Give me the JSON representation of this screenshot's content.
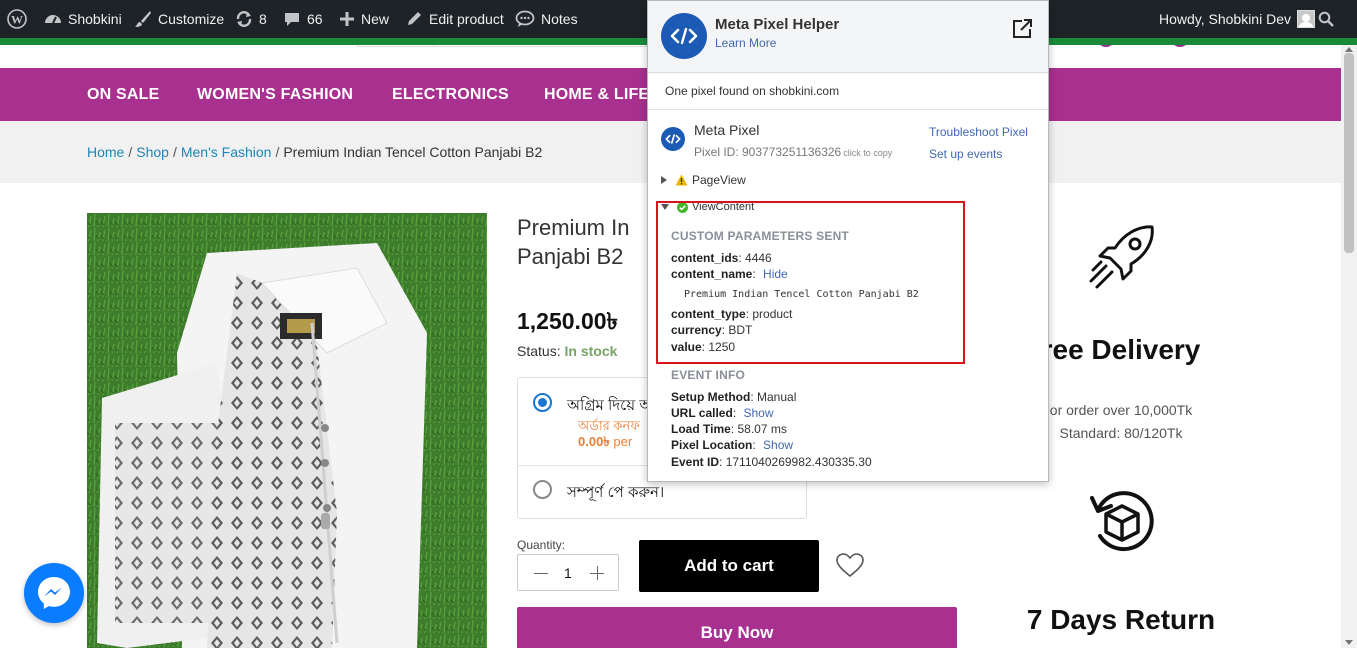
{
  "adminbar": {
    "items": [
      {
        "label": "Shobkini",
        "icon": "dashboard-icon"
      },
      {
        "label": "Customize",
        "icon": "brush-icon"
      },
      {
        "label": "8",
        "icon": "updates-icon"
      },
      {
        "label": "66",
        "icon": "comments-icon"
      },
      {
        "label": "New",
        "icon": "plus-icon"
      },
      {
        "label": "Edit product",
        "icon": "pencil-icon"
      },
      {
        "label": "Notes",
        "icon": "notes-icon"
      }
    ],
    "howdy": "Howdy, Shobkini Dev"
  },
  "nav": {
    "items": [
      "ON SALE",
      "WOMEN'S FASHION",
      "ELECTRONICS",
      "HOME & LIFE"
    ]
  },
  "breadcrumb": {
    "home": "Home",
    "shop": "Shop",
    "category": "Men's Fashion",
    "current": "Premium Indian Tencel Cotton Panjabi B2",
    "sep": "/"
  },
  "product": {
    "title": "Premium In Panjabi B2",
    "price": "1,250.00৳",
    "status_label": "Status:",
    "status_value": "In stock",
    "payment": {
      "option1": "অগ্রিম দিয়ে অ",
      "option1_sub": "অর্ডার কনফ",
      "option1_price": "0.00৳",
      "option1_price_suffix": "per",
      "option2": "সম্পূর্ণ পে করুন।"
    },
    "quantity_label": "Quantity:",
    "quantity": "1",
    "add_to_cart": "Add to cart",
    "buy_now": "Buy Now"
  },
  "features": {
    "delivery_title": "ree Delivery",
    "delivery_line1": "or order over 10,000Tk",
    "delivery_line2": "Standard: 80/120Tk",
    "return_title": "7 Days Return"
  },
  "pixel_helper": {
    "title": "Meta Pixel Helper",
    "learn_more": "Learn More",
    "found": "One pixel found on shobkini.com",
    "pixel_name": "Meta Pixel",
    "pixel_id": "Pixel ID: 903773251136326",
    "click_to_copy": "click to copy",
    "troubleshoot": "Troubleshoot Pixel",
    "setup_events": "Set up events",
    "event_pageview": "PageView",
    "event_viewcontent": "ViewContent",
    "custom_header": "CUSTOM PARAMETERS SENT",
    "params": {
      "content_ids_k": "content_ids",
      "content_ids_v": "4446",
      "content_name_k": "content_name",
      "content_name_link": "Hide",
      "content_name_v": "Premium Indian Tencel Cotton Panjabi B2",
      "content_type_k": "content_type",
      "content_type_v": "product",
      "currency_k": "currency",
      "currency_v": "BDT",
      "value_k": "value",
      "value_v": "1250"
    },
    "event_info_header": "EVENT INFO",
    "info": {
      "setup_k": "Setup Method",
      "setup_v": "Manual",
      "url_k": "URL called",
      "url_link": "Show",
      "load_k": "Load Time",
      "load_v": "58.07 ms",
      "location_k": "Pixel Location",
      "location_link": "Show",
      "event_id_k": "Event ID",
      "event_id_v": "1711040269982.430335.30"
    }
  },
  "colors": {
    "nav_bg": "#a8308f",
    "link": "#1e86b8",
    "in_stock": "#77a464",
    "adminbar": "#1d2327",
    "highlight": "#d9141a",
    "fb_blue": "#1b5bb5"
  }
}
